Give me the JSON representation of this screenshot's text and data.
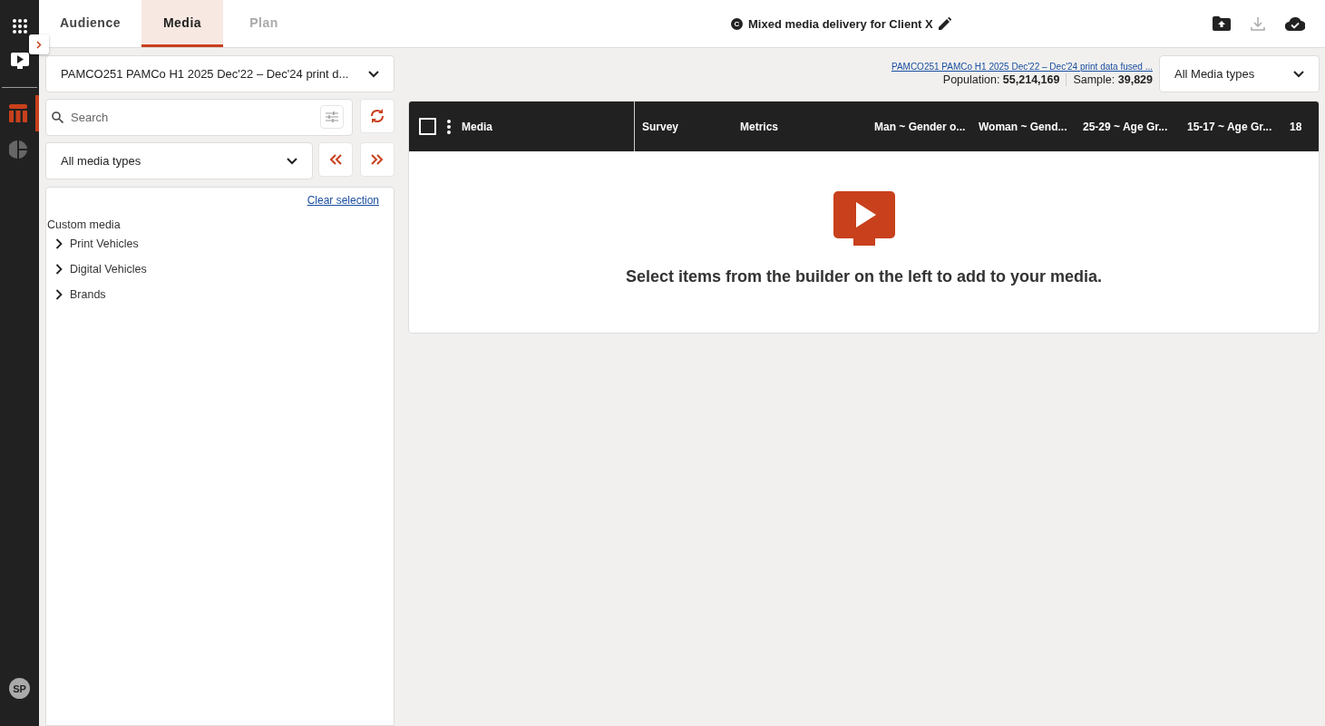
{
  "rail": {
    "items": [
      {
        "kind": "table",
        "selected": true
      },
      {
        "kind": "pie",
        "selected": false
      }
    ],
    "avatar": "SP"
  },
  "tabs": [
    {
      "label": "Audience",
      "selected": false,
      "disabled": false
    },
    {
      "label": "Media",
      "selected": true,
      "disabled": false
    },
    {
      "label": "Plan",
      "selected": false,
      "disabled": true
    }
  ],
  "title": {
    "badge": "C",
    "text": "Mixed media delivery for Client X"
  },
  "survey_select": {
    "value": "PAMCO251 PAMCo H1 2025 Dec'22 – Dec'24 print d..."
  },
  "search": {
    "placeholder": "Search"
  },
  "media_type_select": {
    "value": "All media types"
  },
  "clear_selection": "Clear selection",
  "tree": {
    "title": "Custom media",
    "items": [
      {
        "label": "Print Vehicles",
        "expanded": false
      },
      {
        "label": "Digital Vehicles",
        "expanded": false
      },
      {
        "label": "Brands",
        "expanded": false
      }
    ]
  },
  "survey_link": "PAMCO251 PAMCo H1 2025 Dec'22 – Dec'24 print data fused ...",
  "population": {
    "label": "Population:",
    "value": "55,214,169"
  },
  "sample": {
    "label": "Sample:",
    "value": "39,829"
  },
  "media_types_filter": {
    "value": "All Media types"
  },
  "table": {
    "select_all": {
      "checked": false
    },
    "columns": [
      "Media",
      "Survey",
      "Metrics",
      "Man ~ Gender o...",
      "Woman ~ Gend...",
      "25-29 ~ Age Gr...",
      "15-17 ~ Age Gr...",
      "18"
    ]
  },
  "empty_message": "Select items from the builder on the left to add to your media."
}
